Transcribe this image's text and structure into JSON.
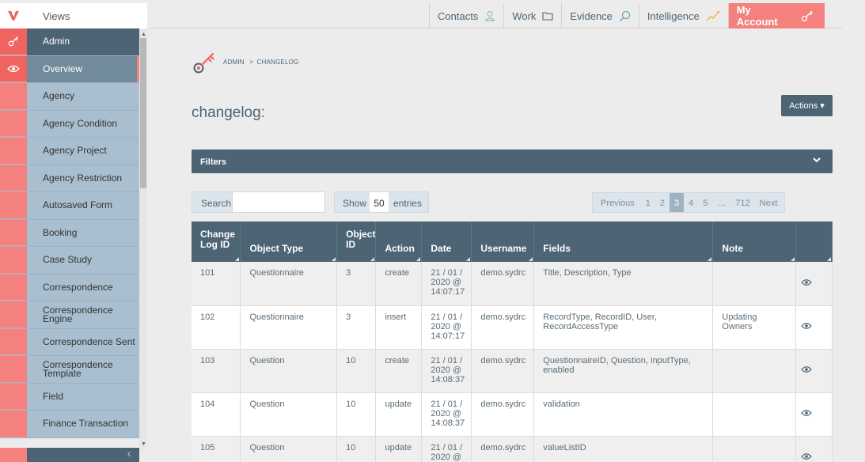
{
  "sidebar": {
    "views_label": "Views",
    "items": [
      {
        "label": "Admin",
        "icon": "key-icon",
        "style": "dark"
      },
      {
        "label": "Overview",
        "icon": "eye-icon",
        "style": "active"
      },
      {
        "label": "Agency"
      },
      {
        "label": "Agency Condition"
      },
      {
        "label": "Agency Project"
      },
      {
        "label": "Agency Restriction"
      },
      {
        "label": "Autosaved Form"
      },
      {
        "label": "Booking"
      },
      {
        "label": "Case Study"
      },
      {
        "label": "Correspondence"
      },
      {
        "label": "Correspondence Engine"
      },
      {
        "label": "Correspondence Sent"
      },
      {
        "label": "Correspondence Template"
      },
      {
        "label": "Field"
      },
      {
        "label": "Finance Transaction"
      }
    ],
    "collapse_icon": "chevron-left-icon"
  },
  "topnav": {
    "contacts": "Contacts",
    "work": "Work",
    "evidence": "Evidence",
    "intelligence": "Intelligence",
    "account": "My Account"
  },
  "breadcrumb": {
    "root": "ADMIN",
    "sep": ">",
    "current": "CHANGELOG"
  },
  "page_title": "changelog:",
  "actions_label": "Actions ▾",
  "filters_label": "Filters",
  "search": {
    "label": "Search:",
    "value": ""
  },
  "show": {
    "label": "Show",
    "value": "50",
    "suffix": "entries"
  },
  "pager": {
    "prev": "Previous",
    "pages": [
      "1",
      "2",
      "3",
      "4",
      "5",
      "…",
      "712"
    ],
    "active": "3",
    "next": "Next"
  },
  "table": {
    "headers": [
      "Change Log ID",
      "Object Type",
      "Object ID",
      "Action",
      "Date",
      "Username",
      "Fields",
      "Note",
      ""
    ],
    "rows": [
      {
        "id": "101",
        "type": "Questionnaire",
        "oid": "3",
        "action": "create",
        "date": "21 / 01 / 2020 @ 14:07:17",
        "user": "demo.sydrc",
        "fields": "Title, Description, Type",
        "note": ""
      },
      {
        "id": "102",
        "type": "Questionnaire",
        "oid": "3",
        "action": "insert",
        "date": "21 / 01 / 2020 @ 14:07:17",
        "user": "demo.sydrc",
        "fields": "RecordType, RecordID, User, RecordAccessType",
        "note": "Updating Owners"
      },
      {
        "id": "103",
        "type": "Question",
        "oid": "10",
        "action": "create",
        "date": "21 / 01 / 2020 @ 14:08:37",
        "user": "demo.sydrc",
        "fields": "QuestionnaireID, Question, inputType, enabled",
        "note": ""
      },
      {
        "id": "104",
        "type": "Question",
        "oid": "10",
        "action": "update",
        "date": "21 / 01 / 2020 @ 14:08:37",
        "user": "demo.sydrc",
        "fields": "validation",
        "note": ""
      },
      {
        "id": "105",
        "type": "Question",
        "oid": "10",
        "action": "update",
        "date": "21 / 01 / 2020 @",
        "user": "demo.sydrc",
        "fields": "valueListID",
        "note": ""
      }
    ]
  },
  "colors": {
    "brand_red": "#f4817d",
    "slate": "#4c6474",
    "sidebar_blue": "#a9bfcf"
  }
}
